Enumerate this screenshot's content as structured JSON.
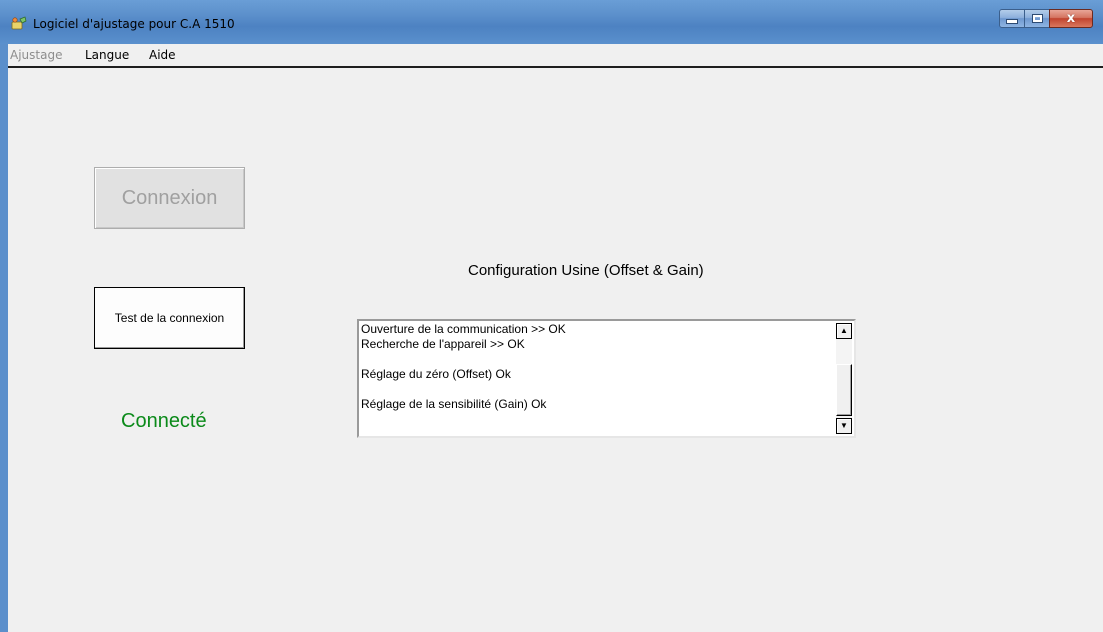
{
  "window": {
    "title": "Logiciel d'ajustage pour C.A 1510",
    "title_bar_color": "#5b8fcb"
  },
  "menu": {
    "items": [
      {
        "label": "Ajustage",
        "enabled": false
      },
      {
        "label": "Langue",
        "enabled": true
      },
      {
        "label": "Aide",
        "enabled": true
      }
    ]
  },
  "buttons": {
    "connexion_label": "Connexion",
    "connexion_enabled": false,
    "test_label": "Test de la connexion"
  },
  "status": {
    "text": "Connecté",
    "color": "#0b8a1a"
  },
  "section": {
    "title": "Configuration Usine (Offset & Gain)"
  },
  "log": {
    "lines": [
      "Ouverture de la communication >> OK",
      "Recherche de l'appareil >> OK",
      "",
      "Réglage du zéro (Offset)  Ok",
      "",
      "Réglage de la sensibilité (Gain)  Ok"
    ]
  },
  "icons": {
    "app": "app-icon",
    "minimize": "minimize-icon",
    "maximize": "maximize-icon",
    "close": "close-icon",
    "scroll_up": "arrow-up-icon",
    "scroll_down": "arrow-down-icon"
  }
}
